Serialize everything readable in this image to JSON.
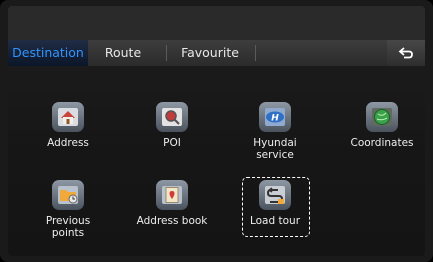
{
  "tabs": {
    "destination": "Destination",
    "route": "Route",
    "favourite": "Favourite"
  },
  "menu": {
    "address": "Address",
    "poi": "POI",
    "hyundai_line1": "Hyundai",
    "hyundai_line2": "service",
    "coordinates": "Coordinates",
    "previous_line1": "Previous",
    "previous_line2": "points",
    "address_book": "Address book",
    "load_tour": "Load tour"
  },
  "icons": {
    "back": "back-arrow-icon",
    "address": "house-icon",
    "poi": "poi-magnifier-icon",
    "hyundai": "hyundai-logo-icon",
    "coordinates": "globe-icon",
    "previous": "folder-clock-icon",
    "address_book": "address-book-icon",
    "load_tour": "load-tour-icon"
  },
  "colors": {
    "active_tab": "#2f95ff",
    "hyundai_blue": "#2f6fc6",
    "globe_green": "#3aa24a"
  }
}
